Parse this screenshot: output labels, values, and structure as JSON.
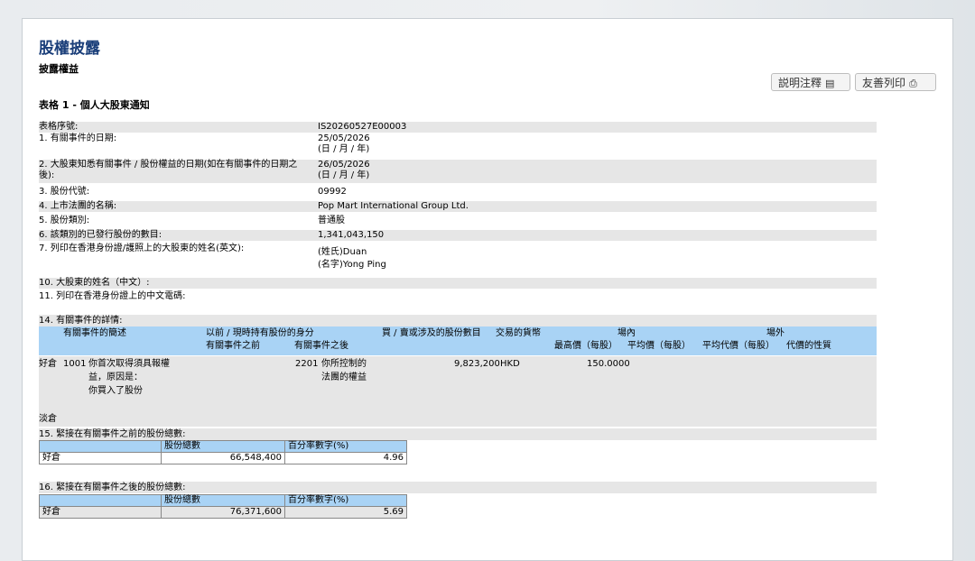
{
  "page": {
    "title": "股權披露",
    "subtitle": "披露權益",
    "form_title": "表格 1 - 個人大股東通知"
  },
  "toolbar": {
    "notes_label": "説明注釋",
    "print_label": "友善列印"
  },
  "fields": {
    "serial_label": "表格序號:",
    "serial_value": "IS20260527E00003",
    "event_date_label": "1. 有關事件的日期:",
    "event_date_value": "25/05/2026",
    "event_date_format": "(日 / 月 / 年)",
    "aware_date_label_1": "2. 大股東知悉有關事件 / 股份權益的日期(如在有關事件的日期之",
    "aware_date_label_2": "後):",
    "aware_date_value": "26/05/2026",
    "aware_date_format": "(日 / 月 / 年)",
    "stock_code_label": "3. 股份代號:",
    "stock_code_value": "09992",
    "corp_name_label": "4. 上市法團的名稱:",
    "corp_name_value": "Pop Mart International Group Ltd.",
    "share_class_label": "5. 股份類別:",
    "share_class_value": "普通股",
    "issued_shares_label": "6. 該類別的已發行股份的數目:",
    "issued_shares_value": "1,341,043,150",
    "english_name_label": "7. 列印在香港身份證/護照上的大股東的姓名(英文):",
    "surname_value": "(姓氏)Duan",
    "given_name_value": "(名字)Yong Ping",
    "chinese_name_label": "10. 大股東的姓名（中文）:",
    "chinese_code_label": "11. 列印在香港身份證上的中文電碼:"
  },
  "details": {
    "section_label": "14. 有關事件的詳情:",
    "headers": {
      "event_desc": "有關事件的簡述",
      "capacity": "以前 / 現時持有股份的身分",
      "capacity_before": "有關事件之前",
      "capacity_after": "有關事件之後",
      "shares_involved": "買 / 賣或涉及的股份數目",
      "currency": "交易的貨幣",
      "on_exchange": "場內",
      "highest_price": "最高價（每股）",
      "avg_price": "平均價（每股）",
      "off_exchange": "場外",
      "off_avg_price": "平均代價（每股）",
      "consideration": "代價的性質"
    },
    "row": {
      "position": "好倉",
      "event_code": "1001",
      "event_desc_1": "你首次取得須具報權",
      "event_desc_2": "益，原因是：",
      "event_desc_3": "你買入了股份",
      "capacity_after_code": "2201",
      "capacity_after_1": "你所控制的",
      "capacity_after_2": "法團的權益",
      "shares": "9,823,200",
      "currency": "HKD",
      "highest_price": "150.0000"
    },
    "short_position": "淡倉"
  },
  "before_totals": {
    "label": "15. 緊接在有關事件之前的股份總數:",
    "col_shares": "股份總數",
    "col_percent": "百分率數字(%)",
    "row_label": "好倉",
    "shares": "66,548,400",
    "percent": "4.96"
  },
  "after_totals": {
    "label": "16. 緊接在有關事件之後的股份總數:",
    "col_shares": "股份總數",
    "col_percent": "百分率數字(%)",
    "row_label": "好倉",
    "shares": "76,371,600",
    "percent": "5.69"
  },
  "icons": {
    "notes": "document-icon",
    "print": "printer-icon"
  }
}
